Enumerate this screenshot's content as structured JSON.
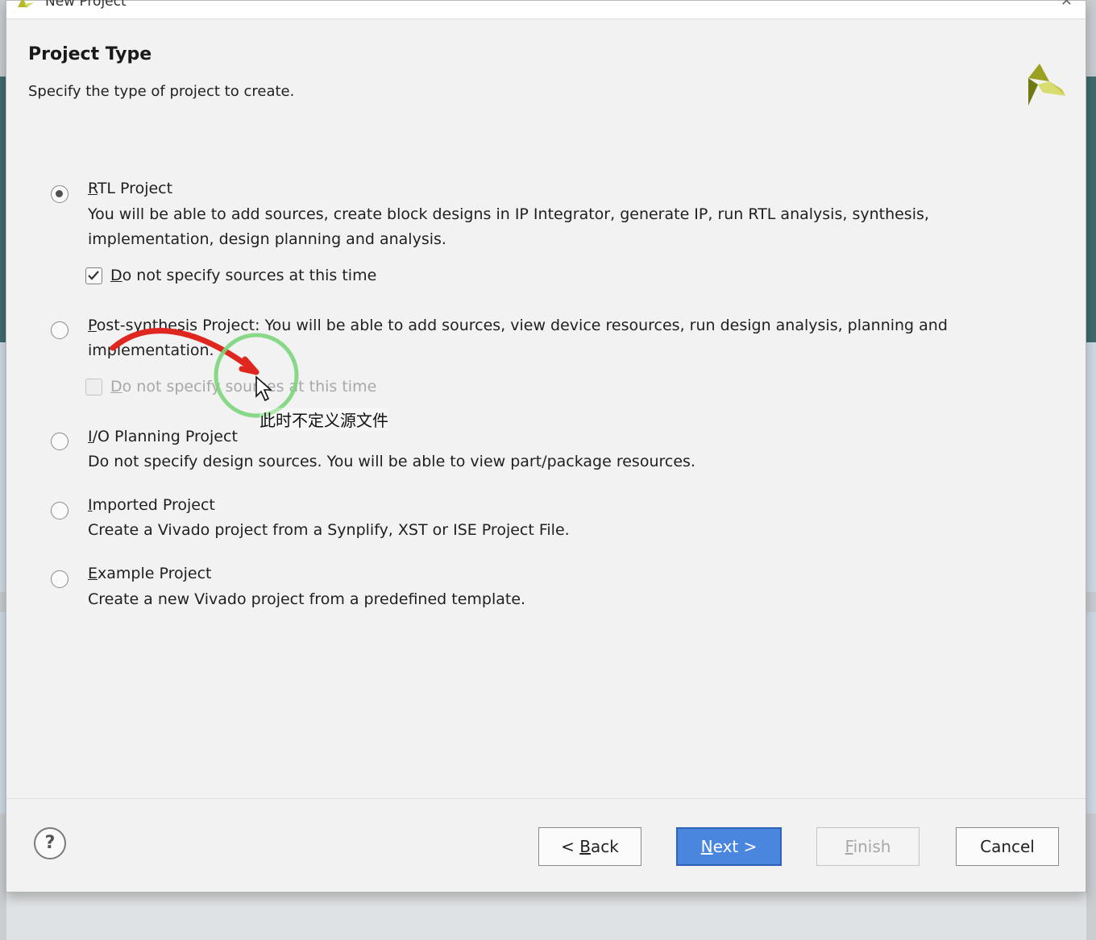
{
  "window": {
    "title": "New Project",
    "close_glyph": "✕"
  },
  "header": {
    "title": "Project Type",
    "subtitle": "Specify the type of project to create."
  },
  "options": [
    {
      "id": "rtl",
      "selected": true,
      "mnemonic": "R",
      "label_rest": "TL Project",
      "description": "You will be able to add sources, create block designs in IP Integrator, generate IP, run RTL analysis, synthesis, implementation, design planning and analysis.",
      "checkbox": {
        "mnemonic": "D",
        "label_rest": "o not specify sources at this time",
        "checked": true,
        "enabled": true
      }
    },
    {
      "id": "post-synthesis",
      "selected": false,
      "mnemonic": "P",
      "label_rest": "ost-synthesis Project:",
      "description": "You will be able to add sources, view device resources, run design analysis, planning and implementation.",
      "checkbox": {
        "mnemonic": "D",
        "label_rest": "o not specify sources at this time",
        "checked": false,
        "enabled": false
      }
    },
    {
      "id": "io-planning",
      "selected": false,
      "mnemonic": "I",
      "label_rest": "/O Planning Project",
      "description": "Do not specify design sources. You will be able to view part/package resources."
    },
    {
      "id": "imported",
      "selected": false,
      "mnemonic": "I",
      "label_rest": "mported Project",
      "description": "Create a Vivado project from a Synplify, XST or ISE Project File."
    },
    {
      "id": "example",
      "selected": false,
      "mnemonic": "E",
      "label_rest": "xample Project",
      "description": "Create a new Vivado project from a predefined template."
    }
  ],
  "footer": {
    "help_glyph": "?",
    "back": {
      "prefix": "< ",
      "mnemonic": "B",
      "rest": "ack"
    },
    "next": {
      "mnemonic": "N",
      "rest": "ext >"
    },
    "finish": {
      "mnemonic": "F",
      "rest": "inish"
    },
    "cancel": "Cancel"
  },
  "annotation": {
    "caption": "此时不定义源文件",
    "arrow_color": "#e0271f",
    "circle_color": "#7bd67b"
  },
  "colors": {
    "accent": "#4a86dd",
    "logo_green": "#b5b82a"
  }
}
